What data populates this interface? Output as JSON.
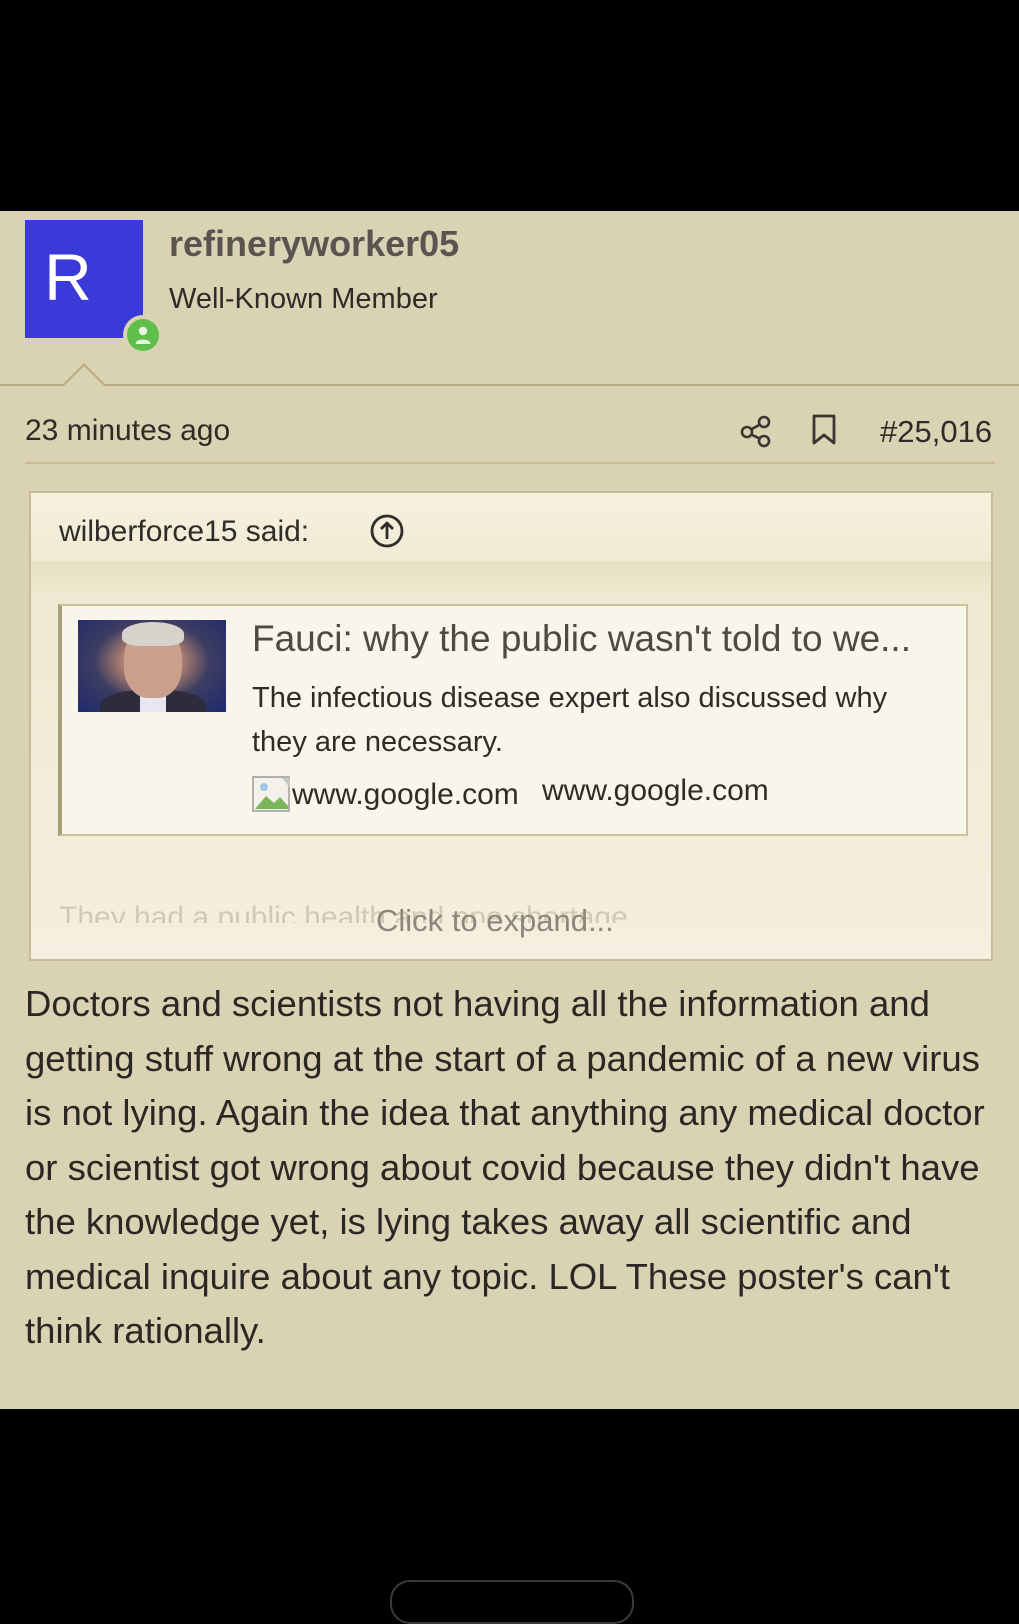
{
  "post": {
    "avatar_letter": "R",
    "username": "refineryworker05",
    "user_title": "Well-Known Member",
    "time": "23 minutes ago",
    "post_number": "#25,016",
    "icons": [
      "share-icon",
      "bookmark-icon",
      "online-status-icon"
    ],
    "colors": {
      "avatar": "#3a3ad9",
      "online": "#5fbf4a",
      "background": "#d9d2b3"
    }
  },
  "quote": {
    "author_line": "wilberforce15 said:",
    "icon": "arrow-up-circle-icon",
    "embed": {
      "title": "Fauci: why the public wasn't told to we...",
      "description": "The infectious disease expert also discussed why they are necessary.",
      "favicon_alt": "www.google.com",
      "domain": "www.google.com"
    },
    "faded_preview": "They had a public health and ppe shortage",
    "expand_label": "Click to expand..."
  },
  "body": {
    "text": "Doctors and scientists not having all the information and getting stuff wrong at the start of a pandemic of a new virus is not lying. Again the idea that anything any medical doctor or scientist got wrong about covid because they didn't have the knowledge yet, is lying takes away all scientific and medical inquire about any topic. LOL These poster's can't think rationally."
  }
}
